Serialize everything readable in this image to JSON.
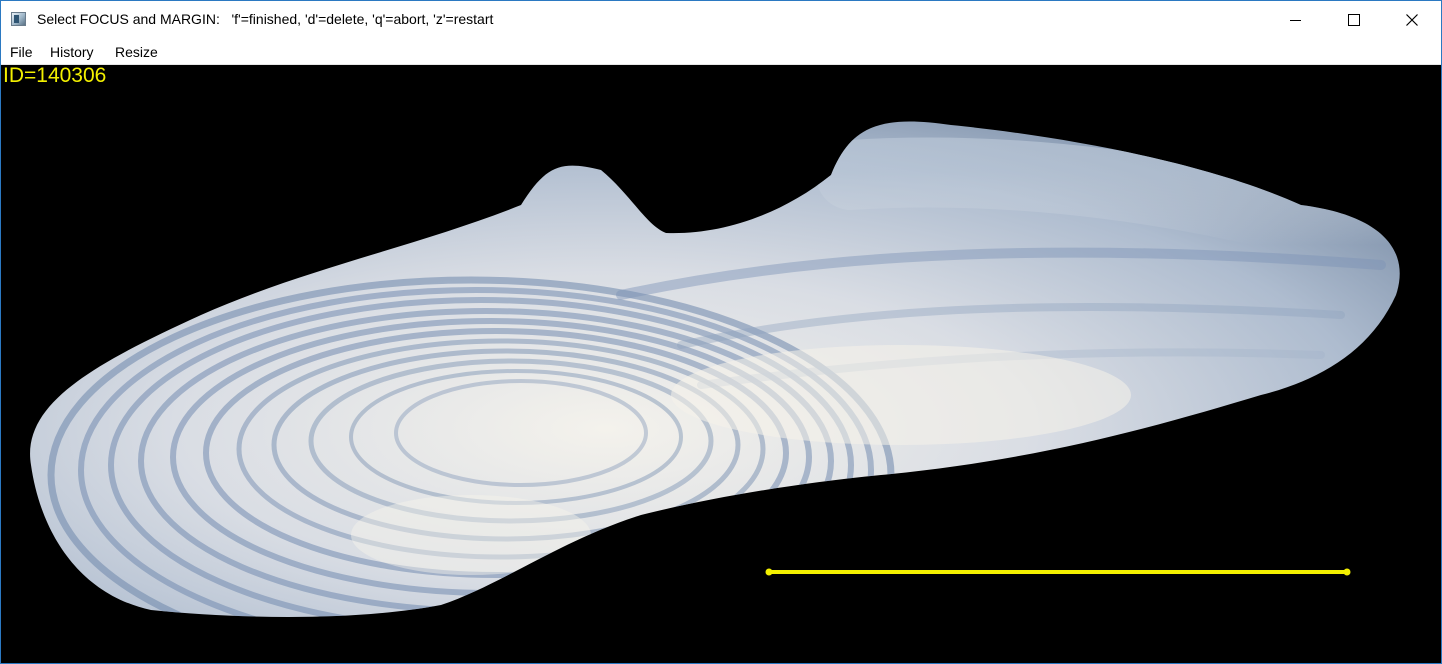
{
  "window": {
    "title": "Select FOCUS and MARGIN:   'f'=finished, 'd'=delete, 'q'=abort, 'z'=restart",
    "controls": {
      "minimize_icon": "minimize-icon",
      "maximize_icon": "maximize-icon",
      "close_icon": "close-icon"
    }
  },
  "menu": {
    "file": "File",
    "history": "History",
    "resize": "Resize"
  },
  "image": {
    "id_label": "ID=140306",
    "subject": "otolith",
    "scale_bar_color": "#f3f000"
  }
}
